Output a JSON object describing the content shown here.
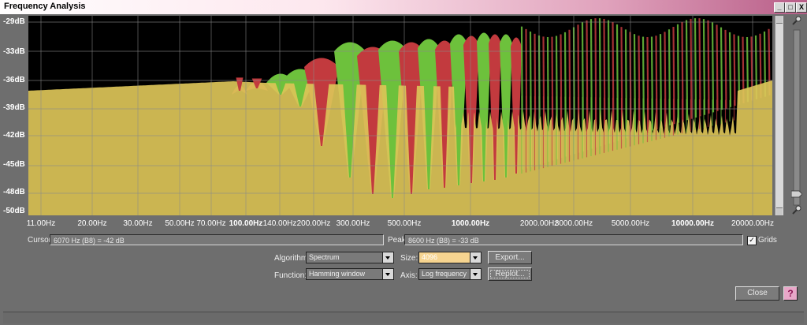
{
  "window": {
    "title": "Frequency Analysis",
    "buttons": [
      "_",
      "□",
      "X"
    ]
  },
  "plot": {
    "y_labels": [
      "-29dB",
      "-33dB",
      "-36dB",
      "-39dB",
      "-42dB",
      "-45dB",
      "-48dB",
      "-50dB"
    ],
    "x_labels": [
      {
        "text": "11.00Hz",
        "bold": false
      },
      {
        "text": "20.00Hz",
        "bold": false
      },
      {
        "text": "30.00Hz",
        "bold": false
      },
      {
        "text": "50.00Hz",
        "bold": false
      },
      {
        "text": "70.00Hz",
        "bold": false
      },
      {
        "text": "100.00Hz",
        "bold": true
      },
      {
        "text": "140.00Hz",
        "bold": false
      },
      {
        "text": "200.00Hz",
        "bold": false
      },
      {
        "text": "300.00Hz",
        "bold": false
      },
      {
        "text": "500.00Hz",
        "bold": false
      },
      {
        "text": "1000.00Hz",
        "bold": true
      },
      {
        "text": "2000.00Hz",
        "bold": false
      },
      {
        "text": "3000.00Hz",
        "bold": false
      },
      {
        "text": "5000.00Hz",
        "bold": false
      },
      {
        "text": "10000.00Hz",
        "bold": true
      },
      {
        "text": "20000.00Hz",
        "bold": false
      }
    ],
    "colors": {
      "background": "#000000",
      "fill": "#dcc458",
      "red": "#c23a3e",
      "green": "#6dc13c",
      "grid": "#8a8a8a"
    }
  },
  "cursor": {
    "label": "Cursor:",
    "value": "6070 Hz (B8) = -42 dB"
  },
  "peak": {
    "label": "Peak:",
    "value": "8600 Hz (B8) = -33 dB"
  },
  "grids": {
    "label": "Grids",
    "checked": true
  },
  "algorithm": {
    "label": "Algorithm:",
    "value": "Spectrum"
  },
  "size": {
    "label": "Size:",
    "value": "4096"
  },
  "function": {
    "label": "Function:",
    "value": "Hamming window"
  },
  "axis": {
    "label": "Axis:",
    "value": "Log frequency"
  },
  "buttons": {
    "export": "Export...",
    "replot": "Replot...",
    "close": "Close",
    "help": "?"
  }
}
